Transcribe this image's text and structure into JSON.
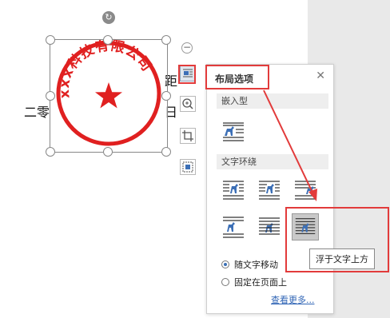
{
  "document": {
    "text_left": "二零",
    "text_right_top": "距",
    "text_right_mid": "日"
  },
  "stamp": {
    "company": "xxx科技有限公司",
    "color": "#e02020"
  },
  "panel": {
    "title": "布局选项",
    "section_inline": "嵌入型",
    "section_wrap": "文字环绕",
    "radio_move": "随文字移动",
    "radio_fixed": "固定在页面上",
    "more_link": "查看更多...",
    "tooltip": "浮于文字上方"
  },
  "icons": [
    "rotate-icon",
    "collapse-icon",
    "layout-options-icon",
    "zoom-in-icon",
    "crop-icon",
    "image-fit-icon",
    "close-icon"
  ],
  "colors": {
    "highlight": "#e23b3b",
    "icon_blue": "#3c6fb6"
  }
}
